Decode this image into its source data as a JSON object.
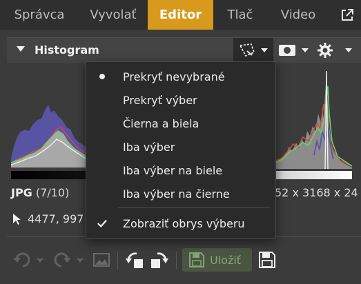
{
  "nav": {
    "tabs": [
      {
        "label": "Správca",
        "active": false
      },
      {
        "label": "Vyvolať",
        "active": false
      },
      {
        "label": "Editor",
        "active": true
      },
      {
        "label": "Tlač",
        "active": false
      },
      {
        "label": "Video",
        "active": false
      }
    ],
    "external_icon": "external-link-icon",
    "accent_color": "#d79a1d"
  },
  "histogram": {
    "title": "Histogram",
    "tools": [
      "selection-overlay-icon",
      "mask-icon",
      "gear-icon"
    ]
  },
  "image_info": {
    "format": "JPG",
    "count": "(7/10)",
    "dimensions": "52 x 3168 x 24",
    "cursor_coords": "4477, 997"
  },
  "menu": {
    "items": [
      {
        "label": "Prekryť nevybrané",
        "mark": "bullet"
      },
      {
        "label": "Prekryť výber",
        "mark": ""
      },
      {
        "label": "Čierna a biela",
        "mark": ""
      },
      {
        "label": "Iba výber",
        "mark": ""
      },
      {
        "label": "Iba výber na biele",
        "mark": ""
      },
      {
        "label": "Iba výber na čierne",
        "mark": ""
      },
      {
        "label": "Zobraziť obrys výberu",
        "mark": "check"
      }
    ]
  },
  "toolbar": {
    "save_label": "Uložiť",
    "icons": [
      "undo-icon",
      "redo-icon",
      "image-icon",
      "rotate-left-icon",
      "rotate-right-icon",
      "save-icon",
      "save-as-icon"
    ],
    "save_color": "#85a477"
  }
}
